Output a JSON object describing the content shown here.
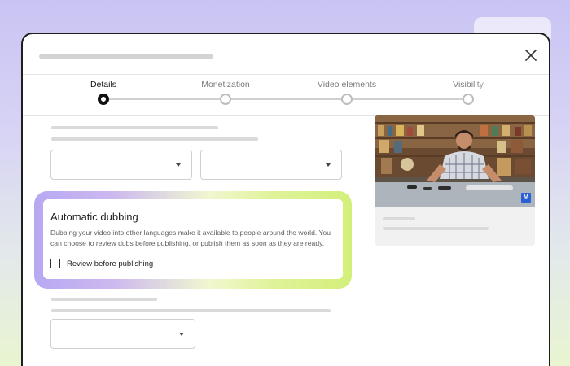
{
  "dialog": {
    "close_icon": "close-icon"
  },
  "stepper": {
    "steps": [
      {
        "label": "Details",
        "state": "active"
      },
      {
        "label": "Monetization",
        "state": "pending"
      },
      {
        "label": "Video elements",
        "state": "pending"
      },
      {
        "label": "Visibility",
        "state": "pending"
      }
    ]
  },
  "dubbing": {
    "title": "Automatic dubbing",
    "description": "Dubbing your video into other languages make it available to people around the world. You can choose to review dubs before publishing, or publish them as soon as they are ready.",
    "checkbox_label": "Review before publishing",
    "checked": false
  },
  "preview": {
    "badge_text": "M",
    "badge_color": "#2b5fd6"
  },
  "colors": {
    "glow_start": "#b8a8f2",
    "glow_end": "#d3ef7a"
  }
}
